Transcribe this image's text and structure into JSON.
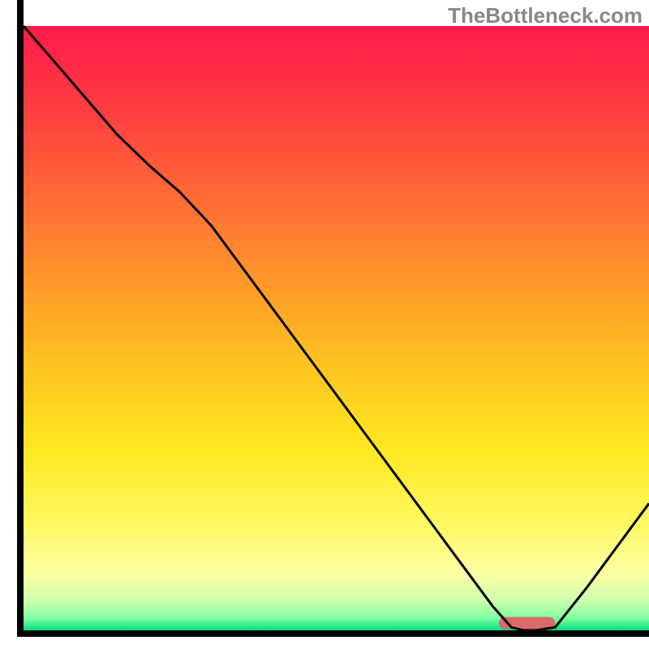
{
  "watermark": "TheBottleneck.com",
  "chart_data": {
    "type": "line",
    "title": "",
    "xlabel": "",
    "ylabel": "",
    "xlim": [
      0,
      100
    ],
    "ylim": [
      0,
      100
    ],
    "x": [
      0,
      5,
      10,
      15,
      20,
      25,
      30,
      35,
      40,
      45,
      50,
      55,
      60,
      65,
      70,
      75,
      78,
      80,
      82,
      85,
      90,
      95,
      100
    ],
    "values": [
      100,
      94,
      88,
      82,
      77,
      72.5,
      67,
      60,
      53,
      46,
      39,
      32,
      25,
      18,
      11,
      4,
      0.5,
      0,
      0,
      0.5,
      7,
      14,
      21
    ],
    "marker_x_range": [
      76,
      85
    ],
    "marker_y": 1.2,
    "gradient_stops": [
      {
        "offset": 0.0,
        "color": "#ff1a4a"
      },
      {
        "offset": 0.15,
        "color": "#ff4040"
      },
      {
        "offset": 0.35,
        "color": "#ff8030"
      },
      {
        "offset": 0.55,
        "color": "#ffc020"
      },
      {
        "offset": 0.7,
        "color": "#ffe820"
      },
      {
        "offset": 0.82,
        "color": "#fff860"
      },
      {
        "offset": 0.9,
        "color": "#ffffa0"
      },
      {
        "offset": 0.95,
        "color": "#d0ffb0"
      },
      {
        "offset": 0.98,
        "color": "#80ffa0"
      },
      {
        "offset": 1.0,
        "color": "#00e080"
      }
    ],
    "marker_color": "#d96a6a",
    "line_color": "#000000",
    "axis_color": "#000000"
  }
}
